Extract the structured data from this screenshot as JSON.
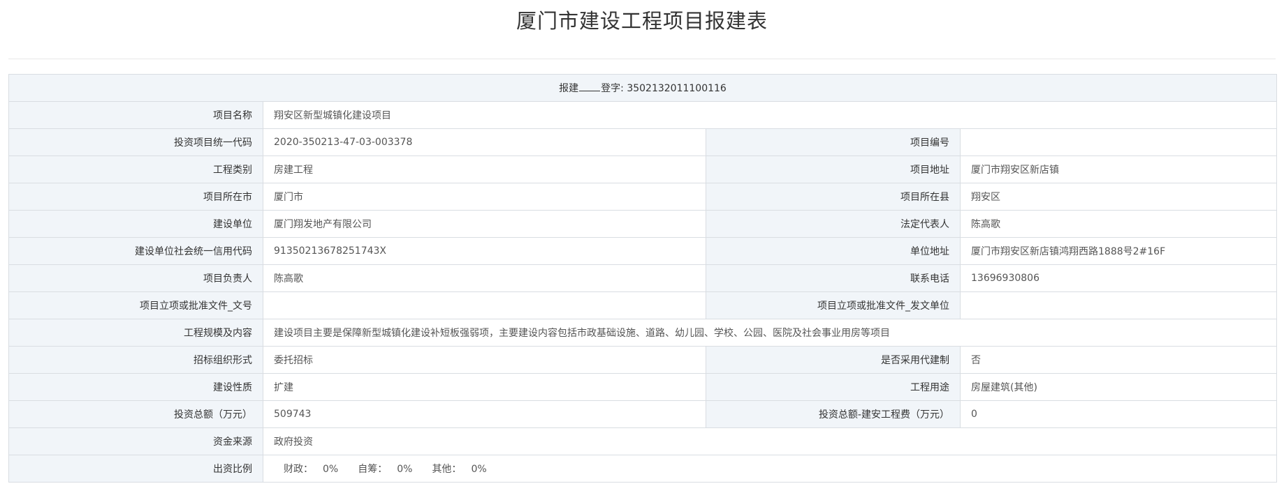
{
  "header": {
    "title": "厦门市建设工程项目报建表"
  },
  "registration": {
    "prefix": "报建",
    "suffix": "登字: 3502132011100116"
  },
  "rows": {
    "project_name": {
      "label": "项目名称",
      "value": "翔安区新型城镇化建设项目"
    },
    "investment_code": {
      "label": "投资项目统一代码",
      "value": "2020-350213-47-03-003378"
    },
    "project_number": {
      "label": "项目编号",
      "value": ""
    },
    "engineering_type": {
      "label": "工程类别",
      "value": "房建工程"
    },
    "project_address": {
      "label": "项目地址",
      "value": "厦门市翔安区新店镇"
    },
    "project_city": {
      "label": "项目所在市",
      "value": "厦门市"
    },
    "project_county": {
      "label": "项目所在县",
      "value": "翔安区"
    },
    "construction_unit": {
      "label": "建设单位",
      "value": "厦门翔发地产有限公司"
    },
    "legal_representative": {
      "label": "法定代表人",
      "value": "陈高歌"
    },
    "credit_code": {
      "label": "建设单位社会统一信用代码",
      "value": "91350213678251743X"
    },
    "unit_address": {
      "label": "单位地址",
      "value": "厦门市翔安区新店镇鸿翔西路1888号2#16F"
    },
    "project_leader": {
      "label": "项目负责人",
      "value": "陈高歌"
    },
    "contact_phone": {
      "label": "联系电话",
      "value": "13696930806"
    },
    "approval_doc_number": {
      "label": "项目立项或批准文件_文号",
      "value": ""
    },
    "approval_doc_issuer": {
      "label": "项目立项或批准文件_发文单位",
      "value": ""
    },
    "scale_content": {
      "label": "工程规模及内容",
      "value": "建设项目主要是保障新型城镇化建设补短板强弱项，主要建设内容包括市政基础设施、道路、幼儿园、学校、公园、医院及社会事业用房等项目"
    },
    "bidding_form": {
      "label": "招标组织形式",
      "value": "委托招标"
    },
    "agent_construction": {
      "label": "是否采用代建制",
      "value": "否"
    },
    "construction_nature": {
      "label": "建设性质",
      "value": "扩建"
    },
    "engineering_use": {
      "label": "工程用途",
      "value": "房屋建筑(其他)"
    },
    "total_investment": {
      "label": "投资总额（万元）",
      "value": "509743"
    },
    "installation_cost": {
      "label": "投资总额-建安工程费（万元）",
      "value": "0"
    },
    "fund_source": {
      "label": "资金来源",
      "value": "政府投资"
    },
    "funding_ratio": {
      "label": "出资比例",
      "items": [
        {
          "name": "财政：",
          "value": "0%"
        },
        {
          "name": "自筹：",
          "value": "0%"
        },
        {
          "name": "其他：",
          "value": "0%"
        }
      ]
    }
  }
}
